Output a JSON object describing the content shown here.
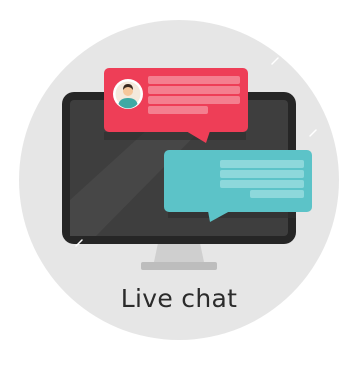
{
  "illustration": {
    "title": "Live chat",
    "icons": {
      "monitor": "monitor-icon",
      "incoming_bubble": "chat-bubble-icon",
      "outgoing_bubble": "chat-bubble-icon",
      "avatar": "user-avatar-icon"
    },
    "colors": {
      "background_circle": "#e6e6e6",
      "monitor_frame": "#2a2a2a",
      "monitor_screen": "#3d3d3d",
      "stand": "#c9c9c9",
      "bubble_red": "#ee3e57",
      "bubble_red_lines": "#f47f8f",
      "bubble_teal": "#5cc3c8",
      "bubble_teal_lines": "#8dd8db",
      "avatar_ring": "#ffffff",
      "avatar_skin": "#f6c79b",
      "avatar_shirt": "#3fa9a4",
      "text": "#2b2b2b"
    }
  }
}
